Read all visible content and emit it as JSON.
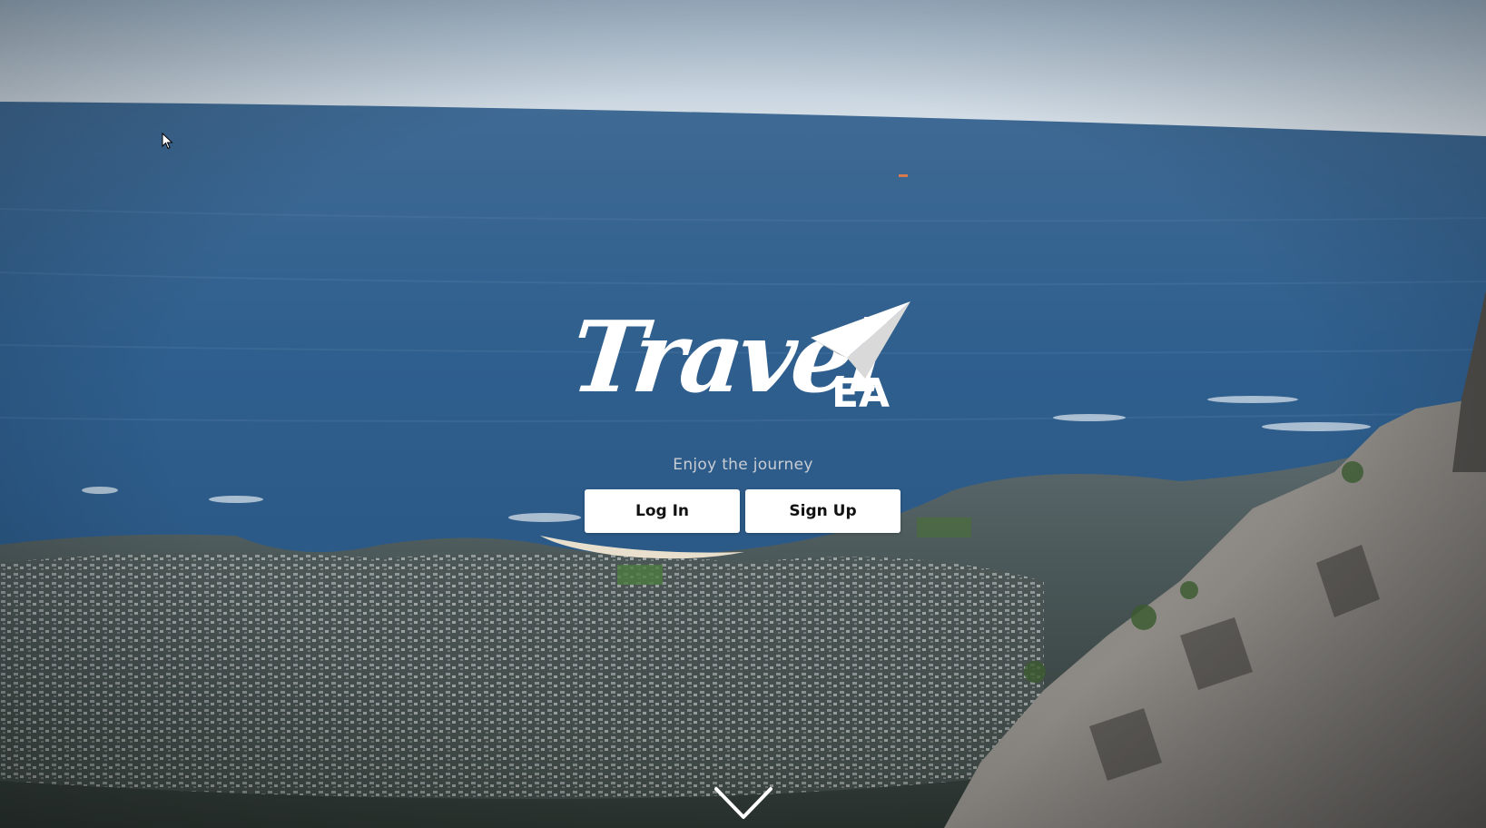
{
  "brand": {
    "name_script": "Travel",
    "name_suffix": "EA"
  },
  "hero": {
    "tagline": "Enjoy the journey",
    "background": "aerial-coastline-photo"
  },
  "actions": {
    "login_label": "Log In",
    "signup_label": "Sign Up",
    "scroll_down_icon": "chevron-down-icon"
  },
  "colors": {
    "button_bg": "#ffffff",
    "button_text": "#111111",
    "tagline_text": "#c8cdd4",
    "logo_text": "#ffffff"
  }
}
